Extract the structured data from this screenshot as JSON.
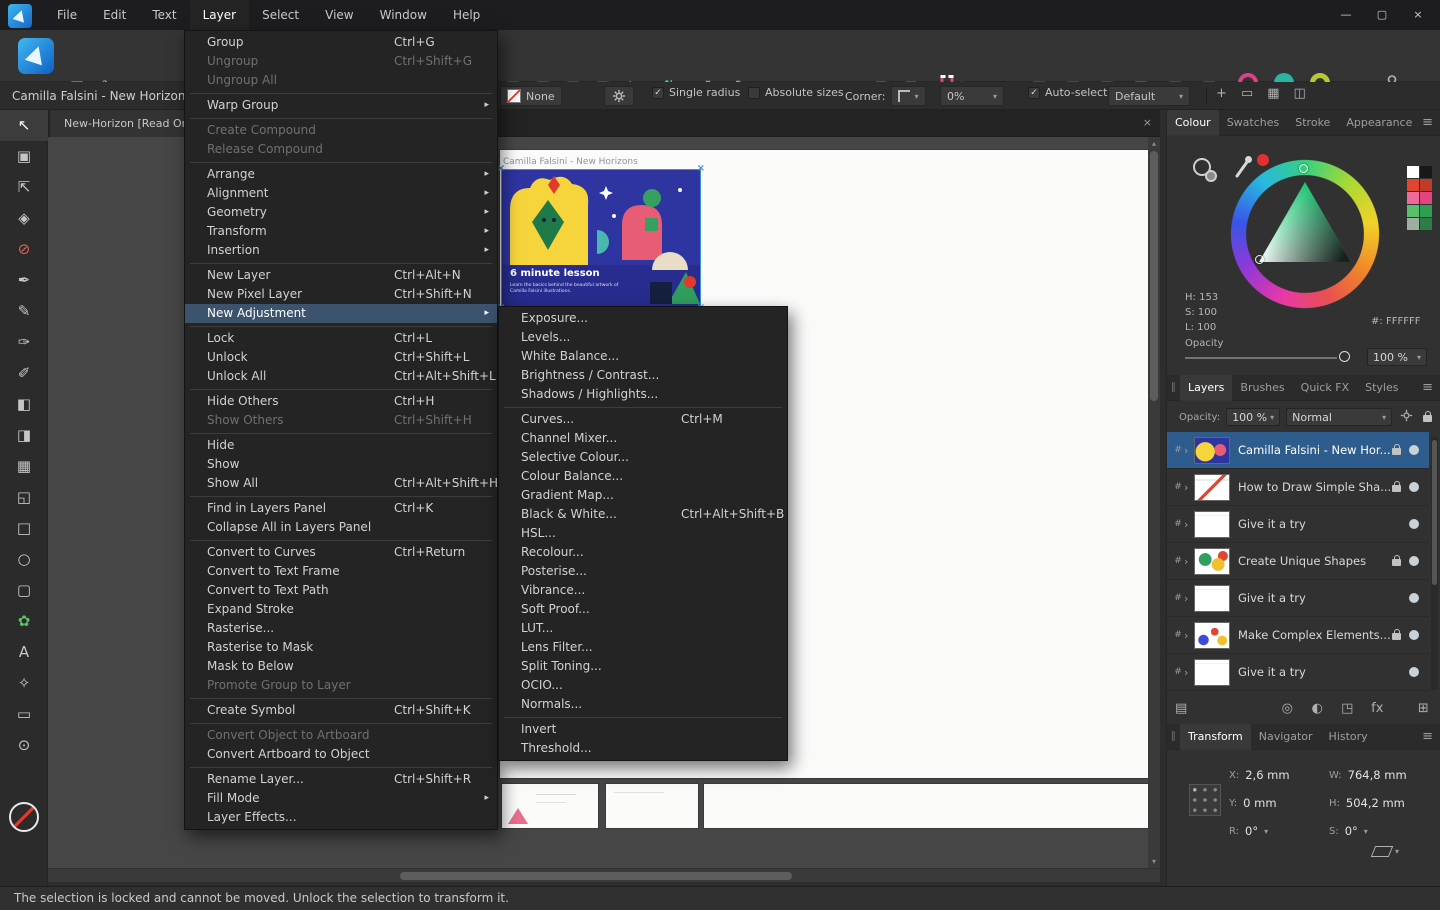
{
  "icons": {
    "hamburger": "≡",
    "submenu_arrow": "▸",
    "chevron_right": "›",
    "caret_down": "▾",
    "check": "✓",
    "close": "×",
    "hash": "#",
    "minimize": "—",
    "maximize": "▢",
    "scroll_up": "▴",
    "scroll_down": "▾",
    "gear": "gear",
    "fx": "fx"
  },
  "menubar": {
    "items": [
      {
        "label": "File"
      },
      {
        "label": "Edit"
      },
      {
        "label": "Text"
      },
      {
        "label": "Layer",
        "active": true
      },
      {
        "label": "Select"
      },
      {
        "label": "View"
      },
      {
        "label": "Window"
      },
      {
        "label": "Help"
      }
    ]
  },
  "layer_menu": {
    "items": [
      {
        "label": "Group",
        "shortcut": "Ctrl+G"
      },
      {
        "label": "Ungroup",
        "shortcut": "Ctrl+Shift+G",
        "disabled": true
      },
      {
        "label": "Ungroup All",
        "disabled": true
      },
      {
        "sep": true
      },
      {
        "label": "Warp Group",
        "submenu": true
      },
      {
        "sep": true
      },
      {
        "label": "Create Compound",
        "disabled": true
      },
      {
        "label": "Release Compound",
        "disabled": true
      },
      {
        "sep": true
      },
      {
        "label": "Arrange",
        "submenu": true
      },
      {
        "label": "Alignment",
        "submenu": true
      },
      {
        "label": "Geometry",
        "submenu": true
      },
      {
        "label": "Transform",
        "submenu": true
      },
      {
        "label": "Insertion",
        "submenu": true
      },
      {
        "sep": true
      },
      {
        "label": "New Layer",
        "shortcut": "Ctrl+Alt+N"
      },
      {
        "label": "New Pixel Layer",
        "shortcut": "Ctrl+Shift+N"
      },
      {
        "label": "New Adjustment",
        "submenu": true,
        "highlighted": true
      },
      {
        "sep": true
      },
      {
        "label": "Lock",
        "shortcut": "Ctrl+L"
      },
      {
        "label": "Unlock",
        "shortcut": "Ctrl+Shift+L"
      },
      {
        "label": "Unlock All",
        "shortcut": "Ctrl+Alt+Shift+L"
      },
      {
        "sep": true
      },
      {
        "label": "Hide Others",
        "shortcut": "Ctrl+H"
      },
      {
        "label": "Show Others",
        "shortcut": "Ctrl+Shift+H",
        "disabled": true
      },
      {
        "sep": true
      },
      {
        "label": "Hide"
      },
      {
        "label": "Show"
      },
      {
        "label": "Show All",
        "shortcut": "Ctrl+Alt+Shift+H"
      },
      {
        "sep": true
      },
      {
        "label": "Find in Layers Panel",
        "shortcut": "Ctrl+K"
      },
      {
        "label": "Collapse All in Layers Panel"
      },
      {
        "sep": true
      },
      {
        "label": "Convert to Curves",
        "shortcut": "Ctrl+Return"
      },
      {
        "label": "Convert to Text Frame"
      },
      {
        "label": "Convert to Text Path"
      },
      {
        "label": "Expand Stroke"
      },
      {
        "label": "Rasterise..."
      },
      {
        "label": "Rasterise to Mask"
      },
      {
        "label": "Mask to Below"
      },
      {
        "label": "Promote Group to Layer",
        "disabled": true
      },
      {
        "sep": true
      },
      {
        "label": "Create Symbol",
        "shortcut": "Ctrl+Shift+K"
      },
      {
        "sep": true
      },
      {
        "label": "Convert Object to Artboard",
        "disabled": true
      },
      {
        "label": "Convert Artboard to Object"
      },
      {
        "sep": true
      },
      {
        "label": "Rename Layer...",
        "shortcut": "Ctrl+Shift+R"
      },
      {
        "label": "Fill Mode",
        "submenu": true
      },
      {
        "label": "Layer Effects..."
      }
    ]
  },
  "adjustment_submenu": {
    "items": [
      {
        "label": "Exposure..."
      },
      {
        "label": "Levels..."
      },
      {
        "label": "White Balance..."
      },
      {
        "label": "Brightness / Contrast..."
      },
      {
        "label": "Shadows / Highlights..."
      },
      {
        "sep": true
      },
      {
        "label": "Curves...",
        "shortcut": "Ctrl+M"
      },
      {
        "label": "Channel Mixer..."
      },
      {
        "label": "Selective Colour..."
      },
      {
        "label": "Colour Balance..."
      },
      {
        "label": "Gradient Map..."
      },
      {
        "label": "Black & White...",
        "shortcut": "Ctrl+Alt+Shift+B"
      },
      {
        "label": "HSL..."
      },
      {
        "label": "Recolour..."
      },
      {
        "label": "Posterise..."
      },
      {
        "label": "Vibrance..."
      },
      {
        "label": "Soft Proof..."
      },
      {
        "label": "LUT..."
      },
      {
        "label": "Lens Filter..."
      },
      {
        "label": "Split Toning..."
      },
      {
        "label": "OCIO..."
      },
      {
        "label": "Normals..."
      },
      {
        "sep": true
      },
      {
        "label": "Invert"
      },
      {
        "label": "Threshold..."
      }
    ]
  },
  "toolbar": {
    "doc_icons": [
      {
        "name": "artboards-icon",
        "glyph": "▦"
      },
      {
        "name": "edit-document-icon",
        "glyph": "✎"
      }
    ],
    "order_icons": [
      {
        "name": "move-to-back-icon",
        "glyph": "◱",
        "disabled": true
      },
      {
        "name": "back-one-icon",
        "glyph": "◲",
        "disabled": true
      },
      {
        "name": "forward-one-icon",
        "glyph": "◳",
        "disabled": true
      },
      {
        "name": "move-to-front-icon",
        "glyph": "◰",
        "disabled": true
      }
    ],
    "transform_icons": [
      {
        "name": "flip-horizontal-icon",
        "glyph": "⇆",
        "color": "#4fb3c9"
      },
      {
        "name": "flip-vertical-icon",
        "glyph": "⇅",
        "color": "#4fb3c9"
      },
      {
        "name": "rotate-ccw-icon",
        "glyph": "↺",
        "color": "#4fb3c9"
      },
      {
        "name": "rotate-cw-icon",
        "glyph": "↻",
        "color": "#4fb3c9"
      }
    ],
    "alignment_glyph": "≡",
    "insert_icons": [
      {
        "name": "insert-inside-icon",
        "glyph": "⊞",
        "disabled": true
      },
      {
        "name": "insert-behind-icon",
        "glyph": "⊟",
        "disabled": true
      }
    ],
    "geometry_icons": [
      {
        "name": "geometry-add-icon",
        "glyph": "◧",
        "disabled": true
      },
      {
        "name": "geometry-subtract-icon",
        "glyph": "◨",
        "disabled": true
      },
      {
        "name": "geometry-intersect-icon",
        "glyph": "◫",
        "disabled": true
      },
      {
        "name": "geometry-divide-icon",
        "glyph": "◩",
        "disabled": true
      },
      {
        "name": "geometry-combine-icon",
        "glyph": "◪",
        "disabled": true
      },
      {
        "name": "geometry-xor-icon",
        "glyph": "▥",
        "disabled": true
      }
    ]
  },
  "context_toolbar": {
    "document_label": "Camilla Falsini - New Horizons (A",
    "fill_label": "None",
    "single_radius": "Single radius",
    "single_radius_checked": true,
    "absolute_sizes": "Absolute sizes",
    "absolute_sizes_checked": false,
    "corner_label": "Corner:",
    "corner_value": "0%",
    "autoselect_label": "Auto-select:",
    "autoselect_checked": true,
    "autoselect_value": "Default",
    "right_icons": [
      {
        "name": "transform-origin-icon",
        "glyph": "+"
      },
      {
        "name": "selection-box-icon",
        "glyph": "▭"
      },
      {
        "name": "pixel-grid-icon",
        "glyph": "▦"
      },
      {
        "name": "grid-options-icon",
        "glyph": "◫"
      }
    ]
  },
  "tools": {
    "items": [
      {
        "name": "move-tool",
        "glyph": "↖",
        "active": true
      },
      {
        "name": "artboard-tool",
        "glyph": "▣"
      },
      {
        "name": "node-tool",
        "glyph": "⇱"
      },
      {
        "name": "point-transform-tool",
        "glyph": "◈"
      },
      {
        "name": "contour-tool",
        "glyph": "⊘",
        "color": "#e06050"
      },
      {
        "name": "pen-tool",
        "glyph": "✒"
      },
      {
        "name": "pencil-tool",
        "glyph": "✎"
      },
      {
        "name": "vector-brush-tool",
        "glyph": "✑"
      },
      {
        "name": "paint-brush-tool",
        "glyph": "✐"
      },
      {
        "name": "fill-tool",
        "glyph": "◧"
      },
      {
        "name": "transparency-tool",
        "glyph": "◨"
      },
      {
        "name": "mesh-warp-tool",
        "glyph": "▦"
      },
      {
        "name": "crop-tool",
        "glyph": "◱"
      },
      {
        "name": "rectangle-tool",
        "glyph": "□"
      },
      {
        "name": "ellipse-tool",
        "glyph": "○"
      },
      {
        "name": "rounded-rectangle-tool",
        "glyph": "▢"
      },
      {
        "name": "shape-tool",
        "glyph": "✿",
        "color": "#5dbf6e"
      },
      {
        "name": "text-tool",
        "glyph": "A"
      },
      {
        "name": "colour-picker-tool",
        "glyph": "✧"
      },
      {
        "name": "measure-tool",
        "glyph": "▭"
      },
      {
        "name": "zoom-tool",
        "glyph": "⊙"
      }
    ]
  },
  "document": {
    "tab_title": "New-Horizon [Read Only]",
    "artboard_label": "Camilla Falsini - New Horizons",
    "artwork_badge": "6 minute lesson",
    "artwork_caption": "Learn the basics behind the beautiful artwork of Camilla Falsini illustrations."
  },
  "colour_panel": {
    "tabs": [
      {
        "label": "Colour",
        "active": true
      },
      {
        "label": "Swatches"
      },
      {
        "label": "Stroke"
      },
      {
        "label": "Appearance"
      }
    ],
    "readouts": [
      {
        "label": "H:",
        "value": "153"
      },
      {
        "label": "S:",
        "value": "100"
      },
      {
        "label": "L:",
        "value": "100"
      }
    ],
    "hex_label": "#:",
    "hex_value": "FFFFFF",
    "opacity_label": "Opacity",
    "opacity_value": "100 %",
    "swatches": [
      {
        "color": "#ffffff"
      },
      {
        "color": "#17181c"
      },
      {
        "color": "#e0452f"
      },
      {
        "color": "#c23a28"
      },
      {
        "color": "#ef6a9a"
      },
      {
        "color": "#e2447e"
      },
      {
        "color": "#58c06a"
      },
      {
        "color": "#2f9e52"
      },
      {
        "color": "#9fae9f"
      },
      {
        "color": "#2e7d46"
      }
    ]
  },
  "layers_panel": {
    "tabs": [
      {
        "label": "Layers",
        "active": true
      },
      {
        "label": "Brushes"
      },
      {
        "label": "Quick FX"
      },
      {
        "label": "Styles"
      }
    ],
    "opacity_label": "Opacity:",
    "opacity_value": "100 %",
    "blend_mode": "Normal",
    "rows": [
      {
        "name": "Camilla Falsini - New Hor...",
        "selected": true,
        "locked": true,
        "thumb": "horizons"
      },
      {
        "name": "How to Draw Simple Sha...",
        "locked": true,
        "thumb": "shapes"
      },
      {
        "name": "Give it a try",
        "thumb": "blank"
      },
      {
        "name": "Create Unique Shapes",
        "locked": true,
        "thumb": "unique"
      },
      {
        "name": "Give it a try",
        "thumb": "blank"
      },
      {
        "name": "Make Complex Elements...",
        "locked": true,
        "thumb": "complex"
      },
      {
        "name": "Give it a try",
        "thumb": "blank"
      }
    ],
    "bottom_icons_mid": [
      {
        "name": "mask-layer-icon",
        "glyph": "◎"
      },
      {
        "name": "adjustment-layer-icon",
        "glyph": "◐"
      },
      {
        "name": "live-filter-icon",
        "glyph": "◳"
      },
      {
        "name": "fx-layer-effects-icon",
        "glyph": "fx"
      }
    ],
    "bottom_icons_right": [
      {
        "name": "add-layer-icon",
        "glyph": "⊞"
      },
      {
        "name": "add-group-icon",
        "glyph": "⊟"
      }
    ],
    "edit_all_layers_glyph": "▤"
  },
  "transform_panel": {
    "tabs": [
      {
        "label": "Transform",
        "active": true
      },
      {
        "label": "Navigator"
      },
      {
        "label": "History"
      }
    ],
    "fields": [
      {
        "label": "X:",
        "value": "2,6 mm"
      },
      {
        "label": "W:",
        "value": "764,8 mm"
      },
      {
        "label": "Y:",
        "value": "0 mm"
      },
      {
        "label": "H:",
        "value": "504,2 mm"
      },
      {
        "label": "R:",
        "value": "0°",
        "dropdown": true
      },
      {
        "label": "S:",
        "value": "0°",
        "dropdown": true
      }
    ]
  },
  "status_bar": {
    "message": "The selection is locked and cannot be moved. Unlock the selection to transform it."
  }
}
